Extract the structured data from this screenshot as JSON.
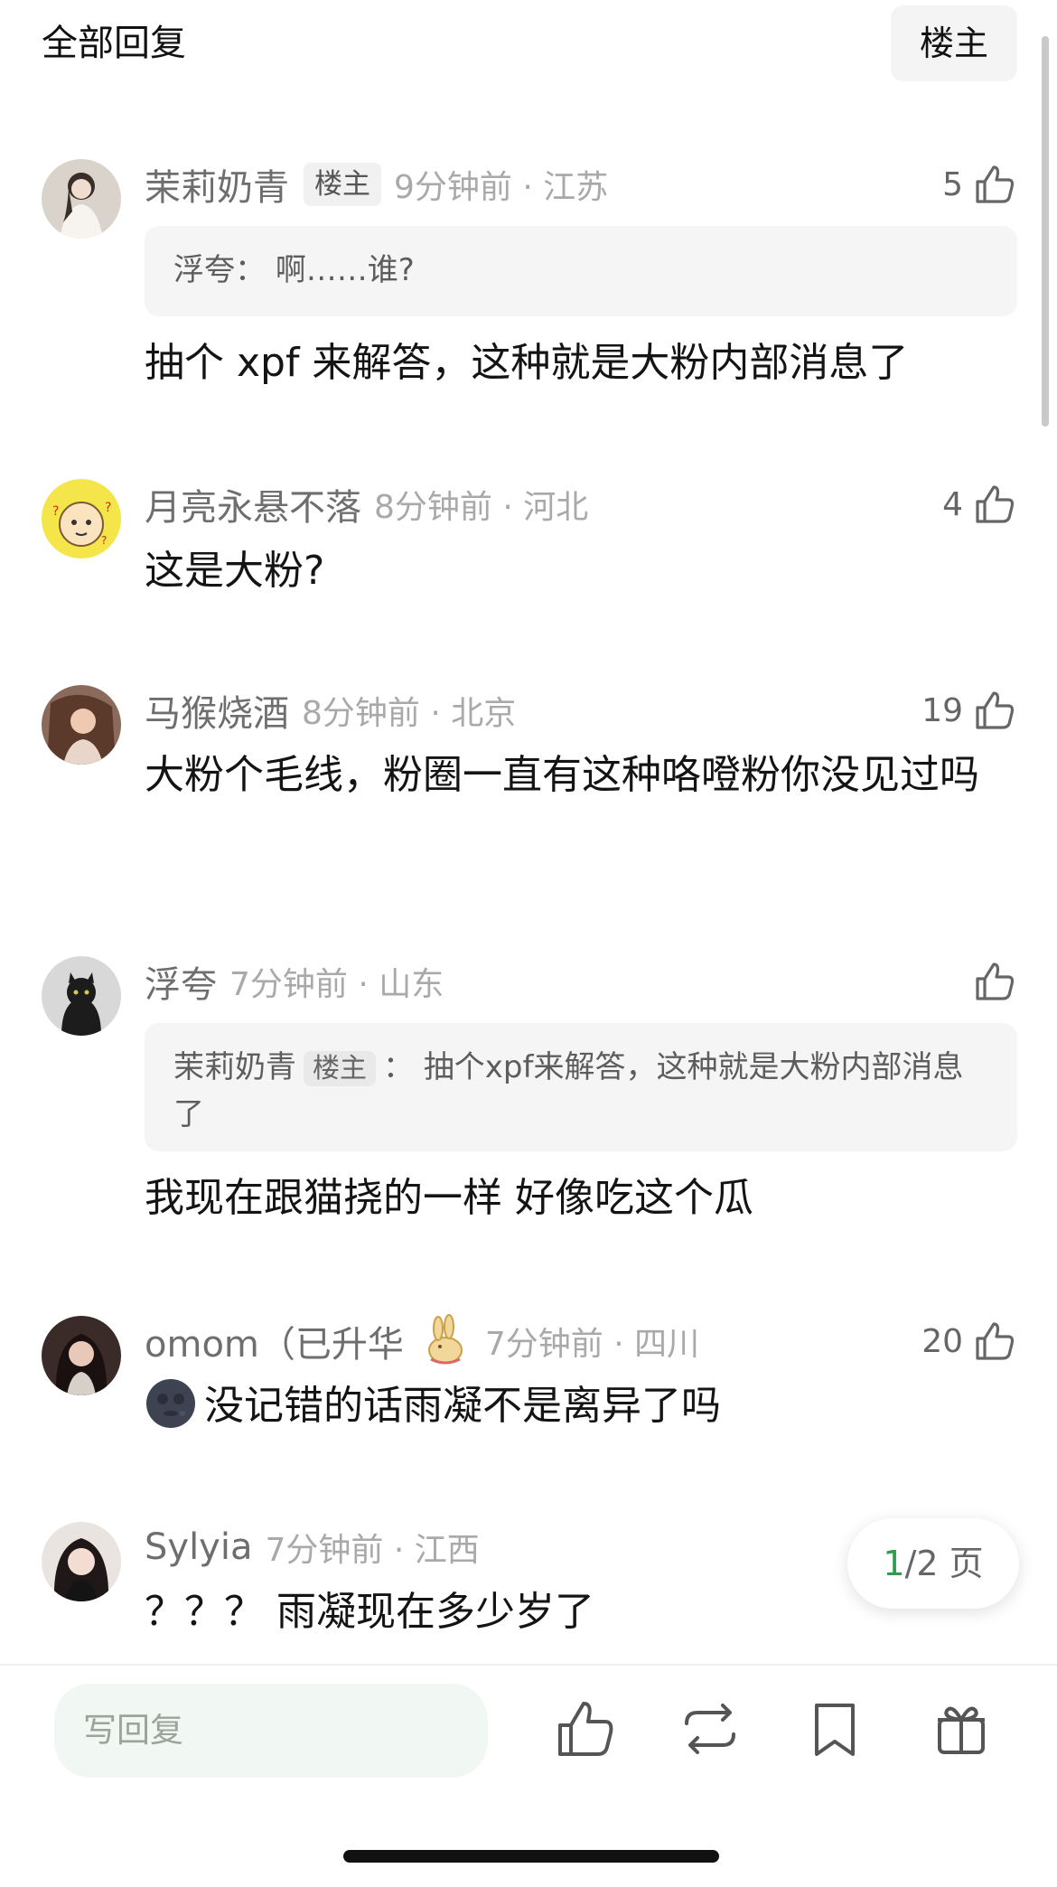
{
  "header": {
    "title": "全部回复",
    "op_button": "楼主"
  },
  "comments": [
    {
      "username": "茉莉奶青",
      "badge": "楼主",
      "time_location": "9分钟前 · 江苏",
      "likes": "5",
      "quote": {
        "author": "浮夸",
        "separator": "：",
        "text": "啊……谁?"
      },
      "text": "抽个 xpf 来解答，这种就是大粉内部消息了"
    },
    {
      "username": "月亮永悬不落",
      "time_location": "8分钟前 · 河北",
      "likes": "4",
      "text": "这是大粉?"
    },
    {
      "username": "马猴烧酒",
      "time_location": "8分钟前 · 北京",
      "likes": "19",
      "text": "大粉个毛线，粉圈一直有这种咯噔粉你没见过吗"
    },
    {
      "username": "浮夸",
      "time_location": "7分钟前 · 山东",
      "likes": "",
      "quote": {
        "author": "茉莉奶青",
        "badge": "楼主",
        "separator": "：",
        "text": "抽个xpf来解答，这种就是大粉内部消息了"
      },
      "text": "我现在跟猫挠的一样 好像吃这个瓜"
    },
    {
      "username": "omom（已升华",
      "time_location": "7分钟前 · 四川",
      "likes": "20",
      "text": "没记错的话雨凝不是离异了吗"
    },
    {
      "username": "Sylyia",
      "time_location": "7分钟前 · 江西",
      "text": "？？？ 雨凝现在多少岁了"
    }
  ],
  "pager": {
    "current": "1",
    "total": "/2 页"
  },
  "bottom_bar": {
    "reply_placeholder": "写回复"
  },
  "icons": {
    "like": "thumbs-up-icon",
    "repost": "repost-icon",
    "bookmark": "bookmark-icon",
    "gift": "gift-icon",
    "badge": "rabbit-badge-icon",
    "emoji": "new-moon-face-emoji"
  },
  "colors": {
    "accent_green": "#2e9d4f",
    "muted_text": "#a9a9a9",
    "input_bg": "#f1f7f3"
  }
}
